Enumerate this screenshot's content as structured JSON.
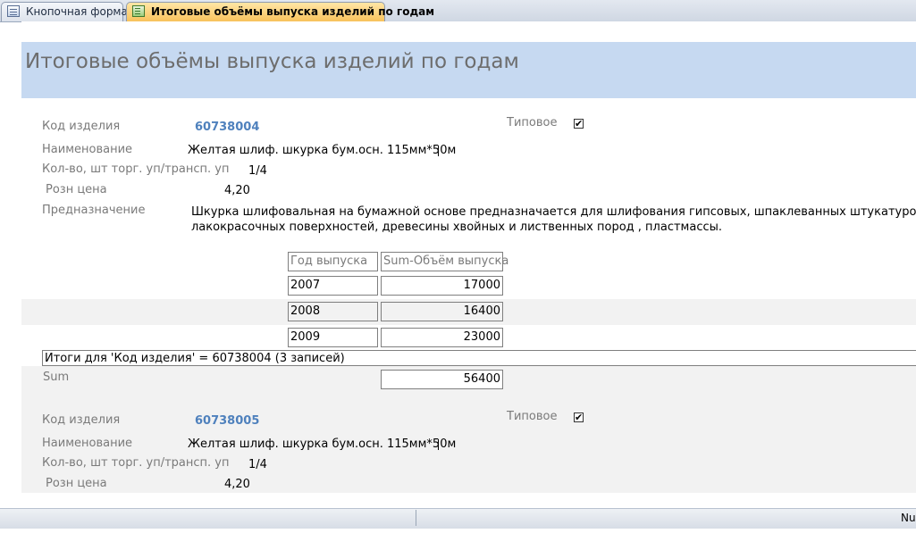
{
  "tabs": [
    {
      "label": "Кнопочная форма",
      "icon": "form-icon",
      "active": false
    },
    {
      "label": "Итоговые объёмы выпуска изделий по годам",
      "icon": "report-icon",
      "active": true
    }
  ],
  "report": {
    "title": "Итоговые объёмы выпуска изделий по годам",
    "labels": {
      "code": "Код изделия",
      "name": "Наименование",
      "qty": "Кол-во, шт торг. уп/трансп. уп",
      "price": "Розн цена",
      "purpose": "Предназначение",
      "typical": "Типовое",
      "sum": "Sum"
    },
    "table_headers": [
      "Год выпуска",
      "Sum-Объём выпуска"
    ],
    "groups": [
      {
        "code": "60738004",
        "name": "Желтая шлиф. шкурка  бум.осн. 115мм*50м",
        "qty": "1/4",
        "price": "4,20",
        "typical": true,
        "purpose_line1": "Шкурка шлифовальная на бумажной основе предназначается для шлифования гипсовых, шпаклеванных штукатурок,",
        "purpose_line2": "лакокрасочных поверхностей, древесины хвойных и лиственных пород , пластмассы.",
        "rows": [
          {
            "year": "2007",
            "volume": "17000"
          },
          {
            "year": "2008",
            "volume": "16400"
          },
          {
            "year": "2009",
            "volume": "23000"
          }
        ],
        "summary_text": "Итоги для 'Код изделия' =  60738004 (3 записей)",
        "sum_value": "56400"
      },
      {
        "code": "60738005",
        "name": "Желтая шлиф. шкурка  бум.осн. 115мм*50м",
        "qty": "1/4",
        "price": "4,20",
        "typical": true
      }
    ]
  },
  "checkbox_mark": "✔",
  "status": {
    "right_text": "Nu"
  }
}
